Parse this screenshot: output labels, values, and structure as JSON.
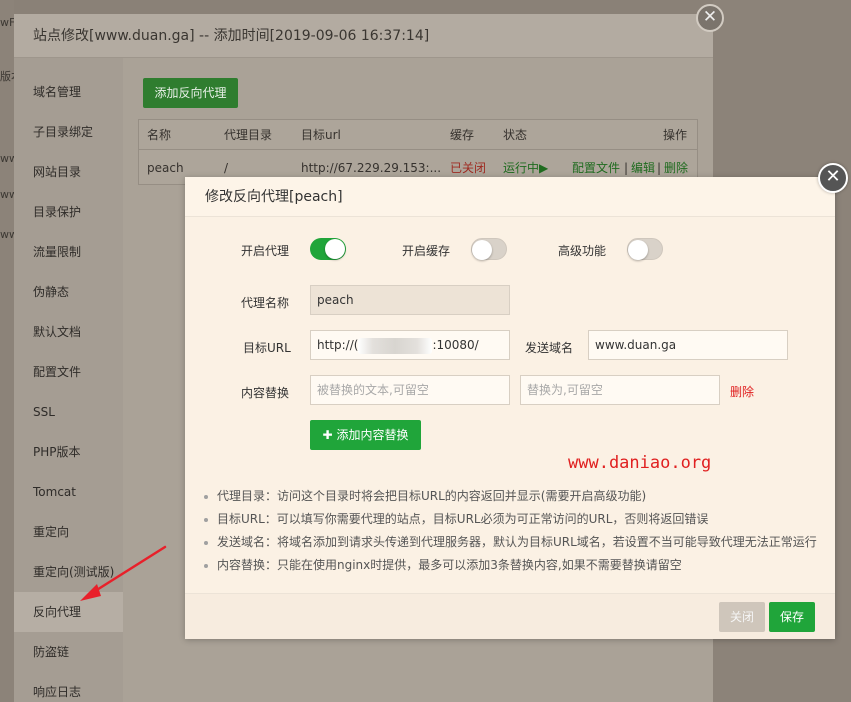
{
  "background": {
    "fragments": [
      "wF",
      "版本",
      "ww",
      "ww",
      "ww"
    ]
  },
  "outer_dialog": {
    "title": "站点修改[www.duan.ga] -- 添加时间[2019-09-06 16:37:14]",
    "close_glyph": "✕",
    "sidebar": {
      "items": [
        {
          "label": "域名管理"
        },
        {
          "label": "子目录绑定"
        },
        {
          "label": "网站目录"
        },
        {
          "label": "目录保护"
        },
        {
          "label": "流量限制"
        },
        {
          "label": "伪静态"
        },
        {
          "label": "默认文档"
        },
        {
          "label": "配置文件"
        },
        {
          "label": "SSL"
        },
        {
          "label": "PHP版本"
        },
        {
          "label": "Tomcat"
        },
        {
          "label": "重定向"
        },
        {
          "label": "重定向(测试版)"
        },
        {
          "label": "反向代理"
        },
        {
          "label": "防盗链"
        },
        {
          "label": "响应日志"
        }
      ],
      "active_label": "反向代理"
    },
    "add_proxy_button": "添加反向代理",
    "table": {
      "headers": [
        "名称",
        "代理目录",
        "目标url",
        "缓存",
        "状态",
        "操作"
      ],
      "rows": [
        {
          "name": "peach",
          "dir": "/",
          "url": "http://67.229.29.153:...",
          "cache": "已关闭",
          "status": "运行中▶",
          "op_config": "配置文件",
          "op_sep1": "|",
          "op_edit": "编辑",
          "op_sep2": "|",
          "op_delete": "删除"
        }
      ]
    }
  },
  "inner_dialog": {
    "title": "修改反向代理[peach]",
    "close_glyph": "✕",
    "toggles": {
      "enable_proxy": {
        "label": "开启代理",
        "on": true
      },
      "enable_cache": {
        "label": "开启缓存",
        "on": false
      },
      "advanced": {
        "label": "高级功能",
        "on": false
      }
    },
    "proxy_name": {
      "label": "代理名称",
      "value": "peach"
    },
    "target_url": {
      "label": "目标URL",
      "prefix": "http://(",
      "suffix": ":10080/"
    },
    "send_domain": {
      "label": "发送域名",
      "value": "www.duan.ga"
    },
    "replace": {
      "label": "内容替换",
      "from_placeholder": "被替换的文本,可留空",
      "to_placeholder": "替换为,可留空",
      "delete_label": "删除"
    },
    "add_replace_button": {
      "plus": "✚",
      "label": "添加内容替换"
    },
    "watermark": "www.daniao.org",
    "notes": [
      "代理目录：访问这个目录时将会把目标URL的内容返回并显示(需要开启高级功能)",
      "目标URL：可以填写你需要代理的站点，目标URL必须为可正常访问的URL，否则将返回错误",
      "发送域名：将域名添加到请求头传递到代理服务器，默认为目标URL域名，若设置不当可能导致代理无法正常运行",
      "内容替换：只能在使用nginx时提供，最多可以添加3条替换内容,如果不需要替换请留空"
    ],
    "footer": {
      "close_label": "关闭",
      "save_label": "保存"
    }
  },
  "colors": {
    "accent_green": "#20a53a",
    "danger_red": "#e02020",
    "annotation_arrow": "#e8202a"
  }
}
